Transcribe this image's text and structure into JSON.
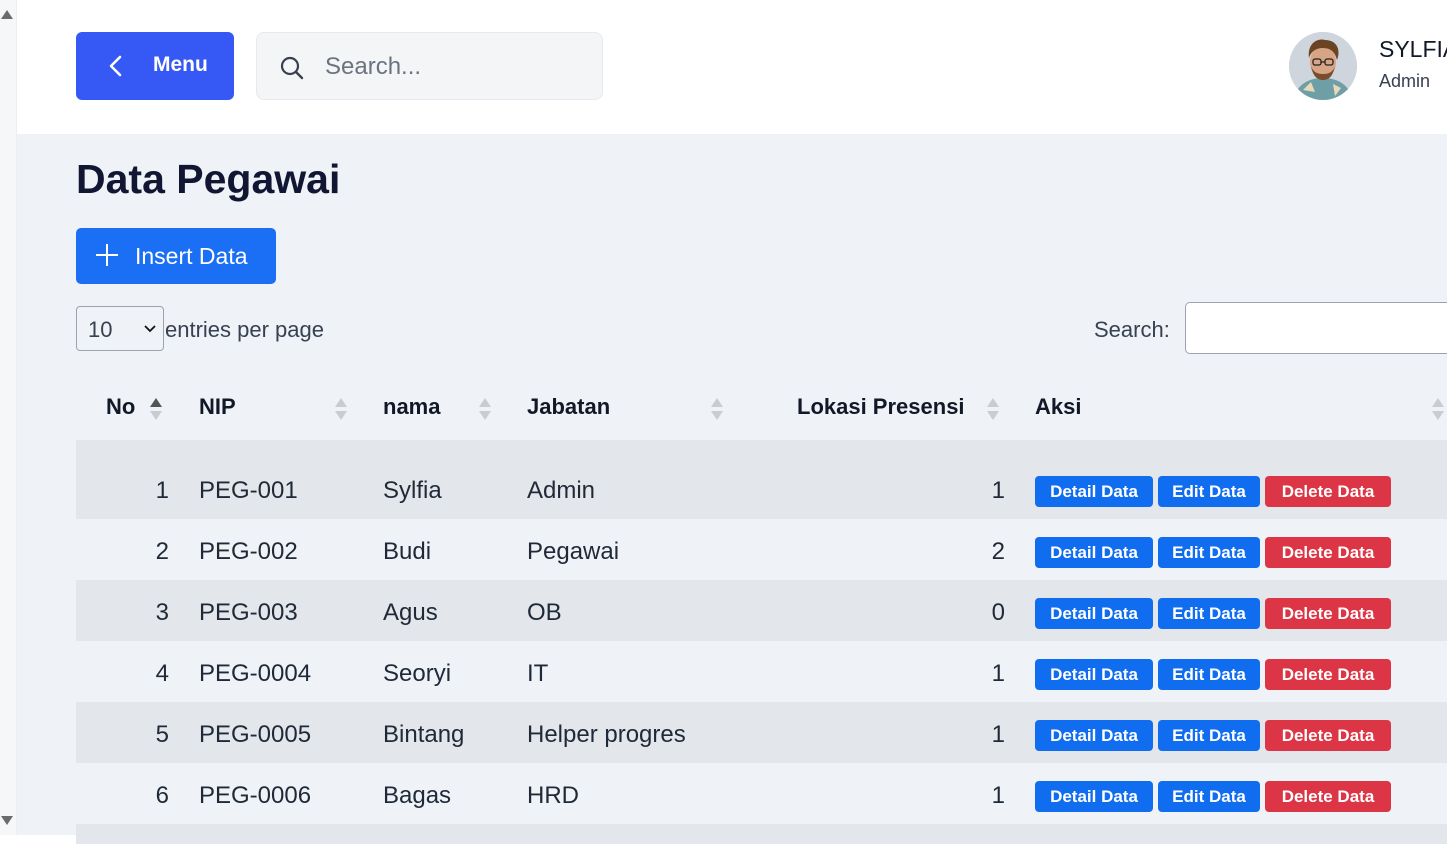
{
  "header": {
    "menu_label": "Menu",
    "search_placeholder": "Search...",
    "user": {
      "name": "SYLFIA",
      "role": "Admin"
    }
  },
  "page": {
    "title": "Data Pegawai",
    "insert_label": "Insert Data",
    "entries": {
      "selected": "10",
      "label": "entries per page"
    },
    "search_label": "Search:"
  },
  "table": {
    "columns": [
      "No",
      "NIP",
      "nama",
      "Jabatan",
      "Lokasi Presensi",
      "Aksi"
    ],
    "actions": {
      "detail": "Detail Data",
      "edit": "Edit Data",
      "delete": "Delete Data"
    },
    "rows": [
      {
        "no": "1",
        "nip": "PEG-001",
        "nama": "Sylfia",
        "jabatan": "Admin",
        "lokasi": "1"
      },
      {
        "no": "2",
        "nip": "PEG-002",
        "nama": "Budi",
        "jabatan": "Pegawai",
        "lokasi": "2"
      },
      {
        "no": "3",
        "nip": "PEG-003",
        "nama": "Agus",
        "jabatan": "OB",
        "lokasi": "0"
      },
      {
        "no": "4",
        "nip": "PEG-0004",
        "nama": "Seoryi",
        "jabatan": "IT",
        "lokasi": "1"
      },
      {
        "no": "5",
        "nip": "PEG-0005",
        "nama": "Bintang",
        "jabatan": "Helper progres",
        "lokasi": "1"
      },
      {
        "no": "6",
        "nip": "PEG-0006",
        "nama": "Bagas",
        "jabatan": "HRD",
        "lokasi": "1"
      }
    ]
  },
  "colors": {
    "menu_button": "#3659f5",
    "primary_button": "#1b6ff4",
    "danger_button": "#dc3545",
    "content_background": "#eff2f7"
  },
  "icons": {
    "menu": "chevron-left-icon",
    "search": "search-icon",
    "insert": "plus-icon",
    "select": "chevron-down-icon",
    "sort": "sort-icon"
  }
}
